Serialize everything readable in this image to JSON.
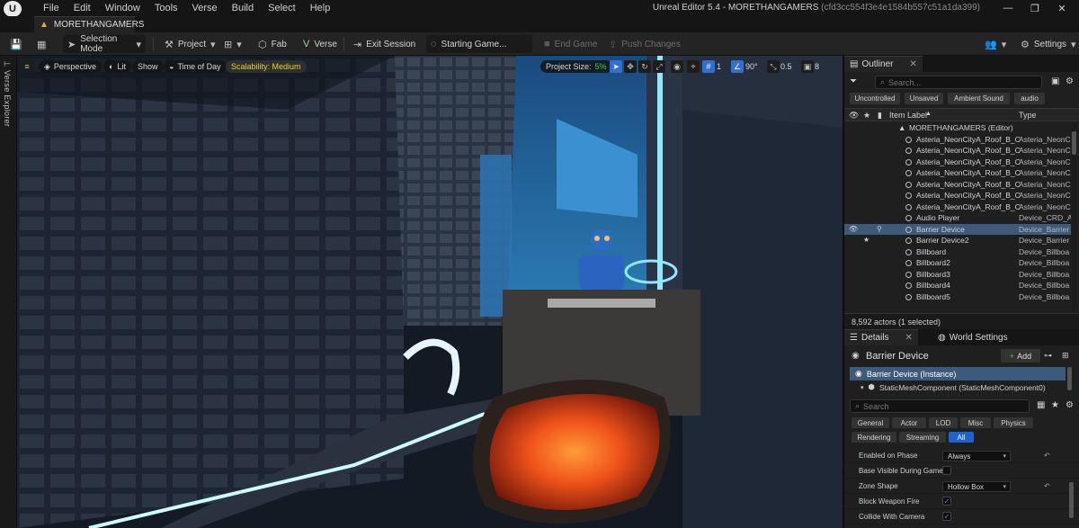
{
  "app": {
    "menu": [
      "File",
      "Edit",
      "Window",
      "Tools",
      "Verse",
      "Build",
      "Select",
      "Help"
    ],
    "window_title": "Unreal Editor 5.4 - MORETHANGAMERS",
    "window_hash": "(cfd3cc554f3e4e1584b557c51a1da399)",
    "level_tab": "MORETHANGAMERS"
  },
  "toolbar": {
    "selection_mode": "Selection Mode",
    "project": "Project",
    "fab": "Fab",
    "verse": "Verse",
    "exit_session": "Exit Session",
    "starting_game": "Starting Game...",
    "end_game": "End Game",
    "push_changes": "Push Changes",
    "settings": "Settings"
  },
  "left_strip": {
    "verse_explorer": "Verse Explorer"
  },
  "viewport": {
    "perspective": "Perspective",
    "lit": "Lit",
    "show": "Show",
    "time_of_day": "Time of Day",
    "scalability": "Scalability: Medium",
    "project_size_label": "Project Size:",
    "project_size_pct": "5%",
    "grid_snap": "1",
    "rot_snap": "90°",
    "scale_snap": "0.5",
    "cam_speed": "8"
  },
  "outliner": {
    "tab": "Outliner",
    "search_placeholder": "Search...",
    "filters": [
      "Uncontrolled",
      "Unsaved",
      "Ambient Sound",
      "audio"
    ],
    "col_label": "Item Label",
    "col_type": "Type",
    "rows": [
      {
        "name": "MORETHANGAMERS (Editor)",
        "type": ""
      },
      {
        "name": "Asteria_NeonCityA_Roof_B_C",
        "type": "Asteria_NeonC"
      },
      {
        "name": "Asteria_NeonCityA_Roof_B_C",
        "type": "Asteria_NeonC"
      },
      {
        "name": "Asteria_NeonCityA_Roof_B_C",
        "type": "Asteria_NeonC"
      },
      {
        "name": "Asteria_NeonCityA_Roof_B_C",
        "type": "Asteria_NeonC"
      },
      {
        "name": "Asteria_NeonCityA_Roof_B_C",
        "type": "Asteria_NeonC"
      },
      {
        "name": "Asteria_NeonCityA_Roof_B_C",
        "type": "Asteria_NeonC"
      },
      {
        "name": "Asteria_NeonCityA_Roof_B_C",
        "type": "Asteria_NeonC"
      },
      {
        "name": "Audio Player",
        "type": "Device_CRD_A"
      },
      {
        "name": "Barrier Device",
        "type": "Device_Barrier"
      },
      {
        "name": "Barrier Device2",
        "type": "Device_Barrier"
      },
      {
        "name": "Billboard",
        "type": "Device_Billboa"
      },
      {
        "name": "Billboard2",
        "type": "Device_Billboa"
      },
      {
        "name": "Billboard3",
        "type": "Device_Billboa"
      },
      {
        "name": "Billboard4",
        "type": "Device_Billboa"
      },
      {
        "name": "Billboard5",
        "type": "Device_Billboa"
      }
    ],
    "footer": "8,592 actors (1 selected)"
  },
  "details": {
    "tab": "Details",
    "world_settings_tab": "World Settings",
    "actor_name": "Barrier Device",
    "add_label": "Add",
    "instance": "Barrier Device (Instance)",
    "component": "StaticMeshComponent (StaticMeshComponent0)",
    "search_placeholder": "Search",
    "filters": [
      "General",
      "Actor",
      "LOD",
      "Misc",
      "Physics",
      "Rendering",
      "Streaming",
      "All"
    ],
    "props": [
      {
        "label": "Enabled on Phase",
        "value": "Always",
        "kind": "combo"
      },
      {
        "label": "Base Visible During Game",
        "value": "",
        "kind": "check"
      },
      {
        "label": "Zone Shape",
        "value": "Hollow Box",
        "kind": "combo"
      },
      {
        "label": "Block Weapon Fire",
        "value": "✓",
        "kind": "check"
      },
      {
        "label": "Collide With Camera",
        "value": "✓",
        "kind": "check"
      }
    ]
  }
}
